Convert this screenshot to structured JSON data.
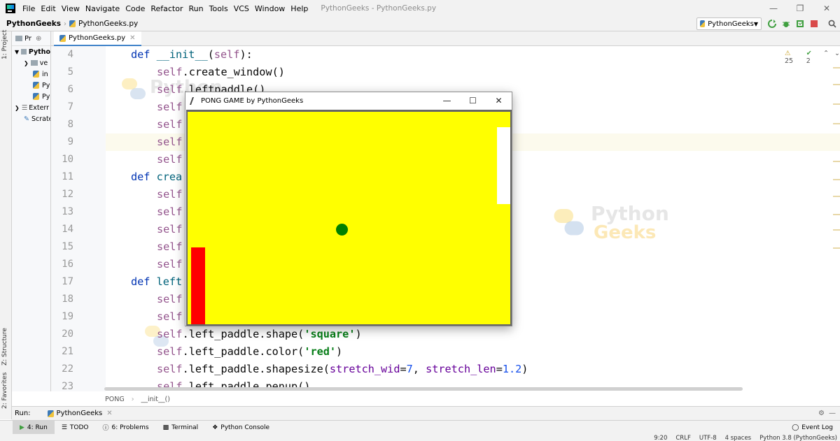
{
  "menubar": {
    "items": [
      "File",
      "Edit",
      "View",
      "Navigate",
      "Code",
      "Refactor",
      "Run",
      "Tools",
      "VCS",
      "Window",
      "Help"
    ],
    "window_title": "PythonGeeks - PythonGeeks.py"
  },
  "navbar": {
    "project": "PythonGeeks",
    "file": "PythonGeeks.py",
    "run_config": "PythonGeeks"
  },
  "left_strip": {
    "project_label": "1: Project",
    "structure_label": "Z: Structure",
    "favorites_label": "2: Favorites"
  },
  "project_panel": {
    "header": "Pr",
    "rows": [
      "Pytho",
      "ve",
      "in",
      "Py",
      "Py",
      "Exterr",
      "Scrate"
    ]
  },
  "editor": {
    "tab": "PythonGeeks.py",
    "inspect_warnings": "25",
    "inspect_ok": "2"
  },
  "code_lines": [
    {
      "num": "4",
      "text": "def __init__(self):"
    },
    {
      "num": "5",
      "text": "self.create_window()"
    },
    {
      "num": "6",
      "text": "self.leftpaddle()"
    },
    {
      "num": "7",
      "text": "self"
    },
    {
      "num": "8",
      "text": "self"
    },
    {
      "num": "9",
      "text": "self"
    },
    {
      "num": "10",
      "text": "self"
    },
    {
      "num": "11",
      "text": "def crea"
    },
    {
      "num": "12",
      "text": "self"
    },
    {
      "num": "13",
      "text": "self"
    },
    {
      "num": "14",
      "text": "self"
    },
    {
      "num": "15",
      "text": "self"
    },
    {
      "num": "16",
      "text": "self"
    },
    {
      "num": "17",
      "text": "def left"
    },
    {
      "num": "18",
      "text": "self"
    },
    {
      "num": "19",
      "text": "self"
    },
    {
      "num": "20",
      "text": "self.left_paddle.shape('square')"
    },
    {
      "num": "21",
      "text": "self.left_paddle.color('red')"
    },
    {
      "num": "22",
      "text": "self.left_paddle.shapesize(stretch_wid=7, stretch_len=1.2)"
    },
    {
      "num": "23",
      "text": "self.left_paddle.penup()"
    }
  ],
  "code_crumbs": {
    "class": "PONG",
    "method": "__init__()"
  },
  "watermark": {
    "line1": "Python",
    "line2": "Geeks"
  },
  "runbar": {
    "label": "Run:",
    "tab": "PythonGeeks"
  },
  "bottom_tools": {
    "run": "4: Run",
    "todo": "TODO",
    "problems": "6: Problems",
    "terminal": "Terminal",
    "console": "Python Console",
    "event_log": "Event Log"
  },
  "statusbar": {
    "position": "9:20",
    "line_sep": "CRLF",
    "encoding": "UTF-8",
    "indent": "4 spaces",
    "interpreter": "Python 3.8 (PythonGeeks)"
  },
  "pong_window": {
    "title": "PONG GAME by PythonGeeks",
    "canvas_color": "#ffff00",
    "left_paddle_color": "#ff0000",
    "right_paddle_color": "#ffffff",
    "ball_color": "#008000"
  }
}
